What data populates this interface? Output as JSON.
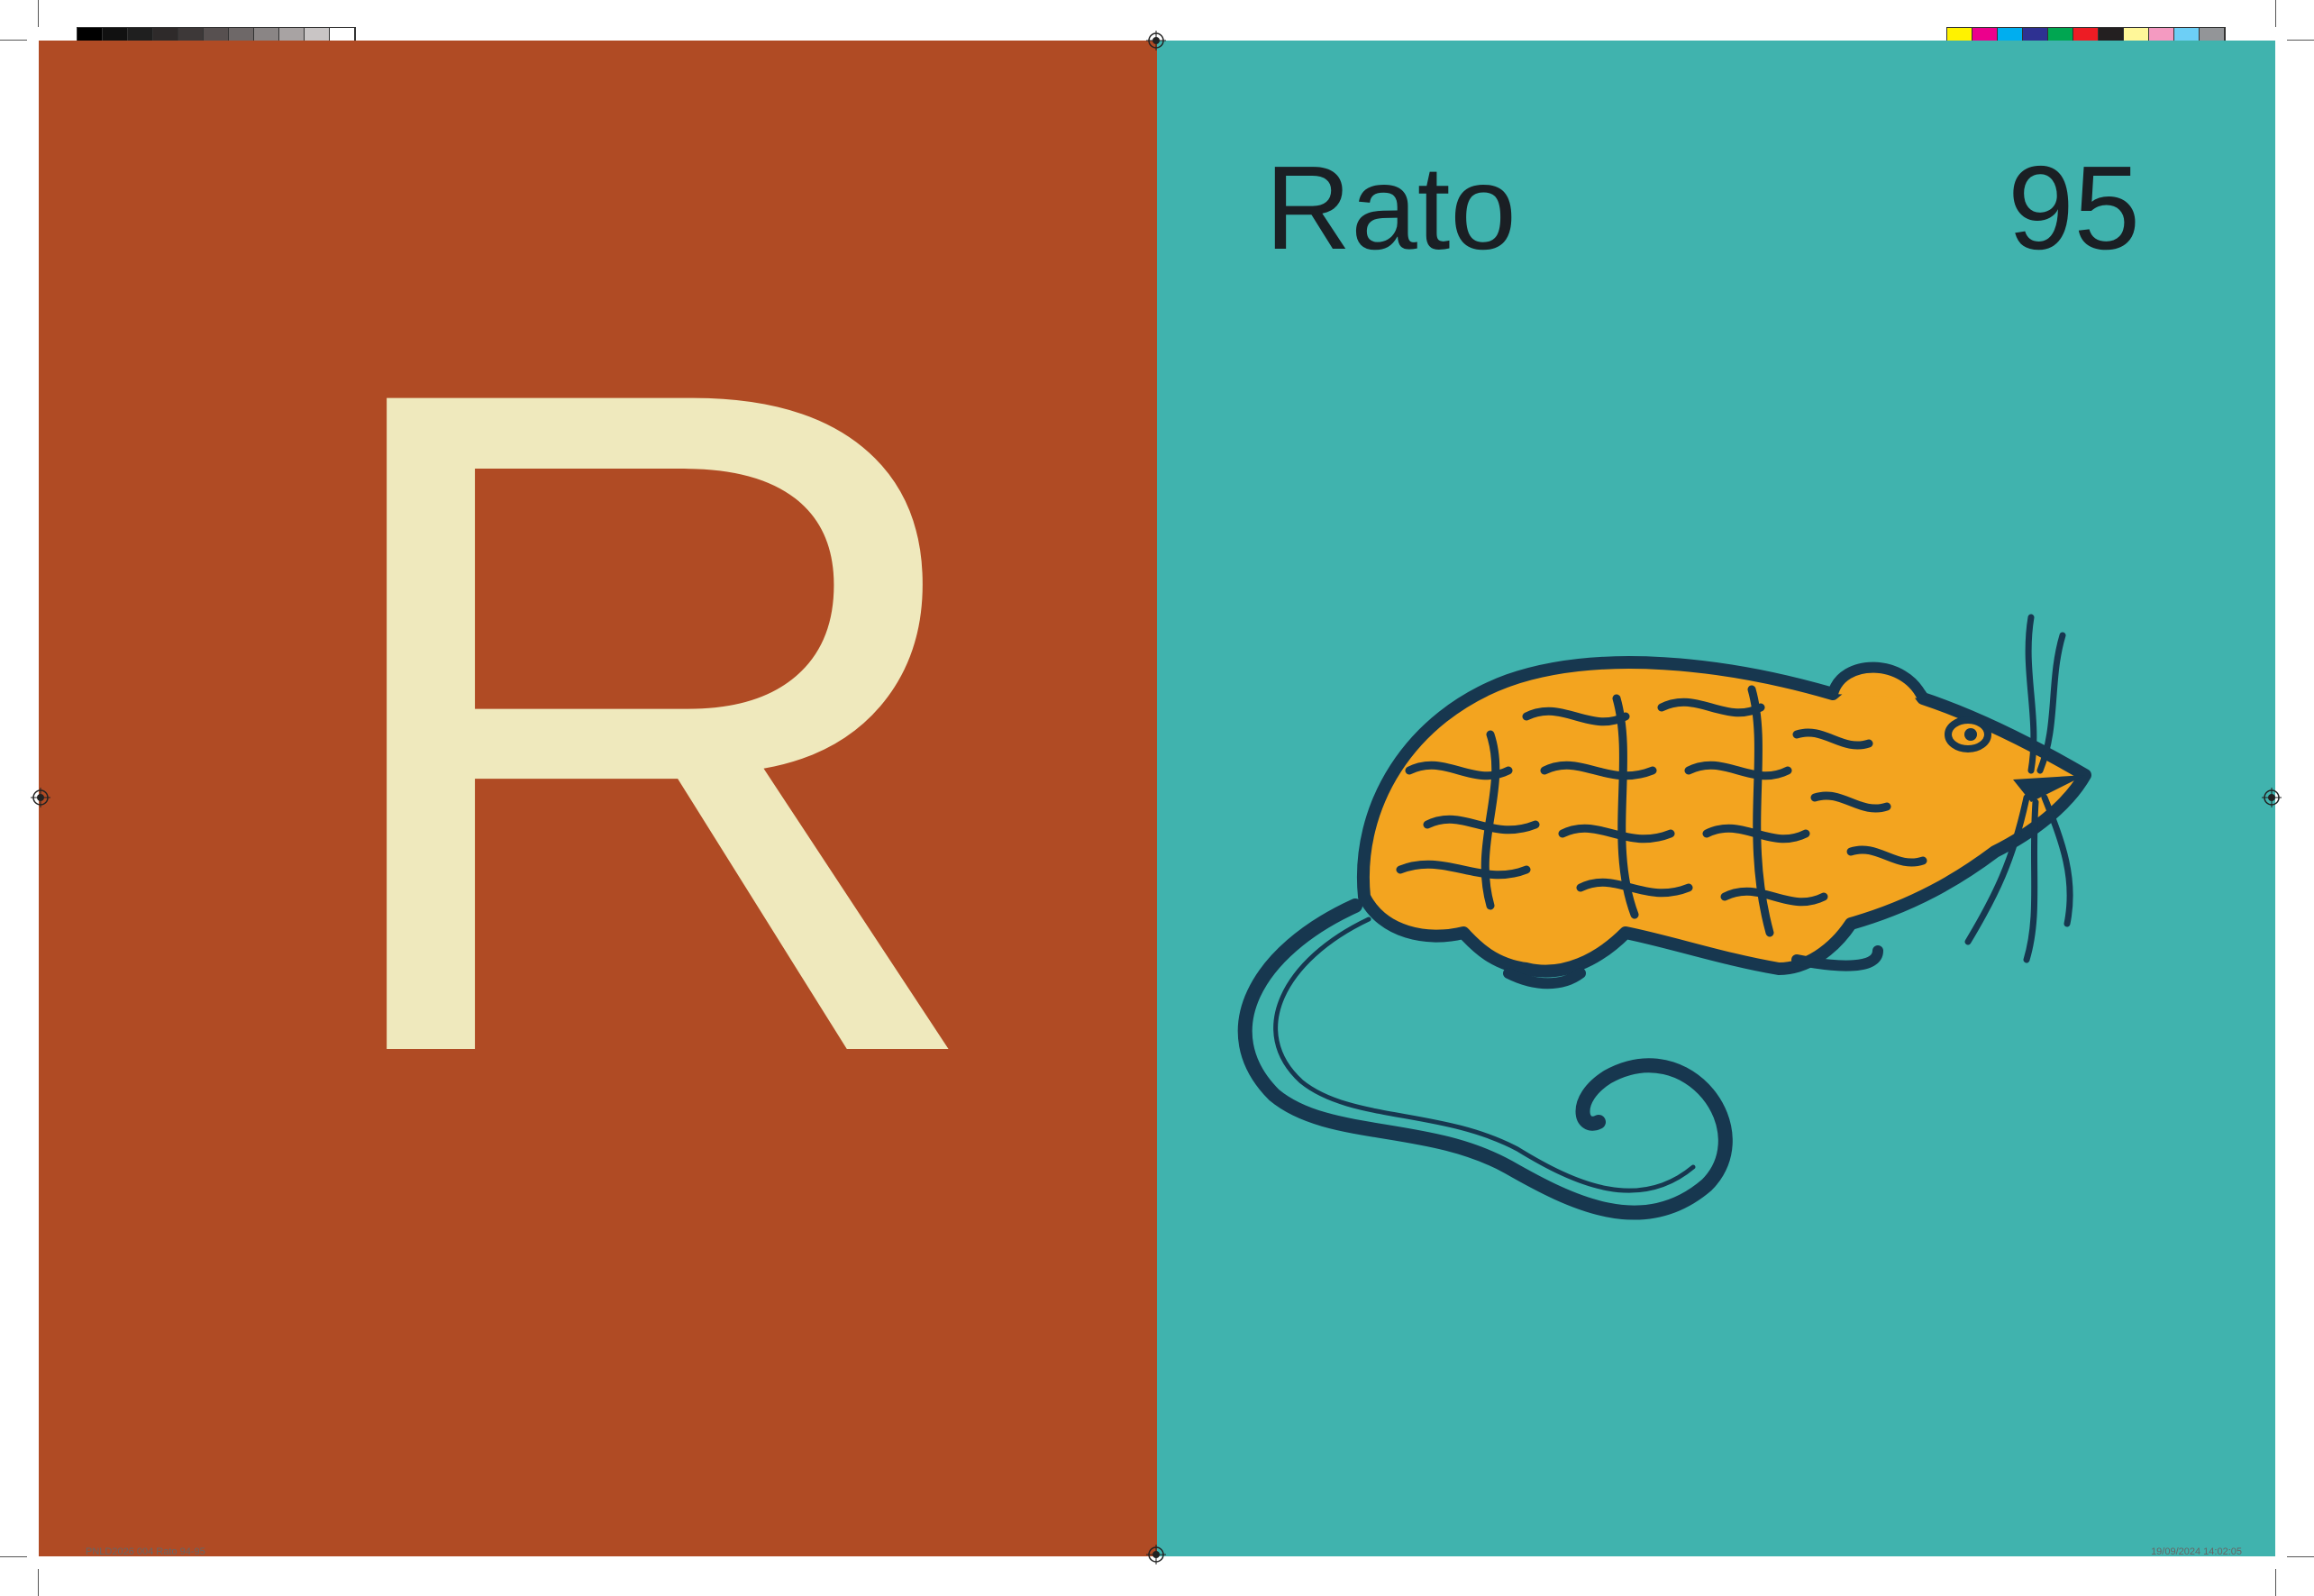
{
  "left_page": {
    "letter": "R",
    "background": "#b04b24",
    "letter_color": "#efe9bd"
  },
  "right_page": {
    "word": "Rato",
    "page_number": "95",
    "background": "#40b3ae",
    "illustration": "rat-illustration",
    "illustration_colors": {
      "outline": "#17374f",
      "fill": "#f3a41f"
    }
  },
  "print_marks": {
    "gray_swatches": [
      "#000000",
      "#111111",
      "#1f1f1f",
      "#2e2a2a",
      "#3d3838",
      "#575050",
      "#6e6868",
      "#8a8585",
      "#a8a3a3",
      "#c9c5c5",
      "#ffffff"
    ],
    "color_swatches": [
      "#fff200",
      "#ec008c",
      "#00aeef",
      "#2e3192",
      "#00a651",
      "#ed1c24",
      "#231f20",
      "#fff799",
      "#f49ac1",
      "#6dcff6",
      "#939598"
    ],
    "slug_left": "PNLD2026 004 Rato   94-95",
    "slug_right": "19/09/2024   14:02:05"
  }
}
